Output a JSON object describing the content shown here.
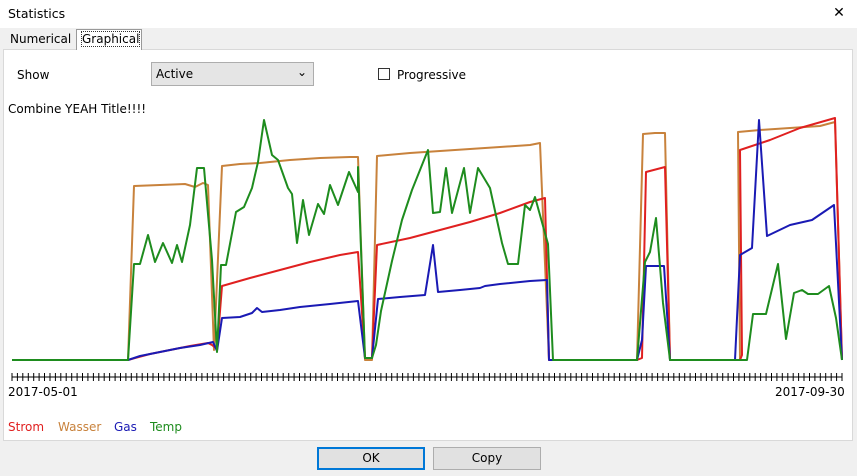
{
  "window": {
    "title": "Statistics",
    "close_glyph": "✕"
  },
  "tabs": [
    {
      "label": "Numerical"
    },
    {
      "label": "Graphical"
    }
  ],
  "controls": {
    "show_label": "Show",
    "show_value": "Active",
    "progressive_label": "Progressive",
    "progressive_checked": false
  },
  "chart_data": {
    "type": "line",
    "title": "Combine YEAH Title!!!!",
    "x_start": "2017-05-01",
    "x_end": "2017-09-30",
    "grid": false,
    "legend_placement": "bottom-left",
    "series": [
      {
        "name": "Strom",
        "color": "#e02020"
      },
      {
        "name": "Wasser",
        "color": "#c8823c"
      },
      {
        "name": "Gas",
        "color": "#1a1ab4"
      },
      {
        "name": "Temp",
        "color": "#1e8c1e"
      }
    ]
  },
  "buttons": {
    "ok": "OK",
    "copy": "Copy"
  }
}
